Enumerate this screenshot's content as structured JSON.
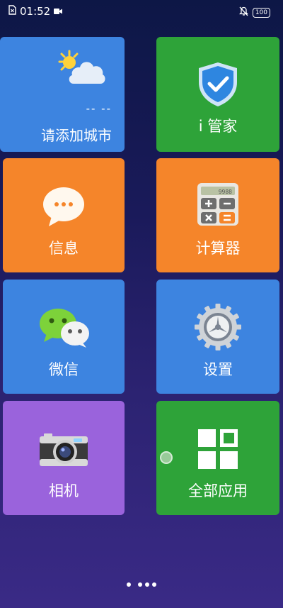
{
  "status_bar": {
    "time": "01:52",
    "battery": "100"
  },
  "tiles": {
    "weather": {
      "temp": "-- --",
      "label": "请添加城市",
      "color": "#3d84e0",
      "icon": "weather-partly-cloudy-icon"
    },
    "imanager": {
      "label": "i 管家",
      "color": "#2ea339",
      "icon": "shield-check-icon"
    },
    "messages": {
      "label": "信息",
      "color": "#f5852a",
      "icon": "chat-bubble-icon"
    },
    "calculator": {
      "label": "计算器",
      "color": "#f5852a",
      "icon": "calculator-icon",
      "display": "9988"
    },
    "wechat": {
      "label": "微信",
      "color": "#3d84e0",
      "icon": "wechat-icon"
    },
    "settings": {
      "label": "设置",
      "color": "#3d84e0",
      "icon": "gear-icon"
    },
    "camera": {
      "label": "相机",
      "color": "#9a63dc",
      "icon": "camera-icon"
    },
    "all_apps": {
      "label": "全部应用",
      "color": "#2ea339",
      "icon": "app-grid-icon"
    }
  },
  "page_indicator": {
    "pages": 4,
    "current": 1
  }
}
